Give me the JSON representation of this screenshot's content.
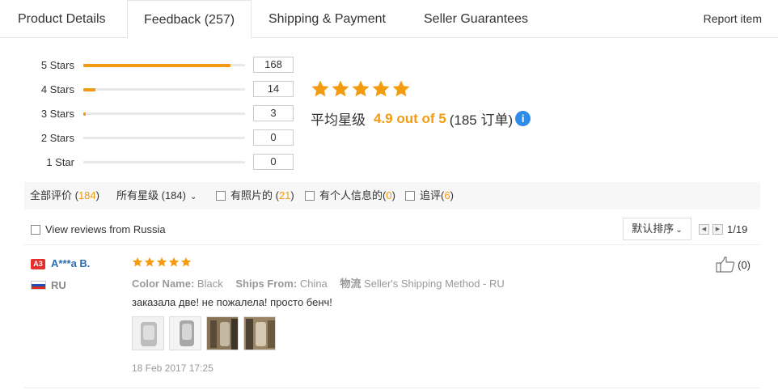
{
  "tabs": [
    {
      "label": "Product Details"
    },
    {
      "label": "Feedback (257)"
    },
    {
      "label": "Shipping & Payment"
    },
    {
      "label": "Seller Guarantees"
    }
  ],
  "report_label": "Report item",
  "distribution": [
    {
      "label": "5 Stars",
      "count": "168",
      "fill": 0.91
    },
    {
      "label": "4 Stars",
      "count": "14",
      "fill": 0.076
    },
    {
      "label": "3 Stars",
      "count": "3",
      "fill": 0.016
    },
    {
      "label": "2 Stars",
      "count": "0",
      "fill": 0
    },
    {
      "label": "1 Star",
      "count": "0",
      "fill": 0
    }
  ],
  "summary": {
    "stars": 5,
    "prefix": "平均星级",
    "score": "4.9 out of 5",
    "orders": "(185 订单)",
    "info_icon": "info-icon"
  },
  "filters": {
    "all_label": "全部评价 (",
    "all_count": "184",
    "all_close": ")",
    "stars_dropdown": "所有星级 (184)",
    "photos_label": "有照片的 (",
    "photos_count": "21",
    "photos_close": ")",
    "personal_label": "有个人信息的(",
    "personal_count": "0",
    "personal_close": ")",
    "followup_label": "追评(",
    "followup_count": "6",
    "followup_close": ")"
  },
  "russia_label": "View reviews from Russia",
  "sort_label": "默认排序",
  "pager": {
    "text": "1/19"
  },
  "review": {
    "badge": "A3",
    "username": "A***a B.",
    "country": "RU",
    "stars": 5,
    "color_key": "Color Name:",
    "color_val": "Black",
    "ships_key": "Ships From:",
    "ships_val": "China",
    "logistics_key": "物流",
    "logistics_val": "Seller's Shipping Method - RU",
    "text": "заказала две! не пожалела! просто бенч!",
    "date": "18 Feb 2017 17:25",
    "helpful_count": "(0)"
  },
  "colors": {
    "accent": "#f39c12",
    "link": "#2b6cb3",
    "info": "#2e8ce8"
  }
}
